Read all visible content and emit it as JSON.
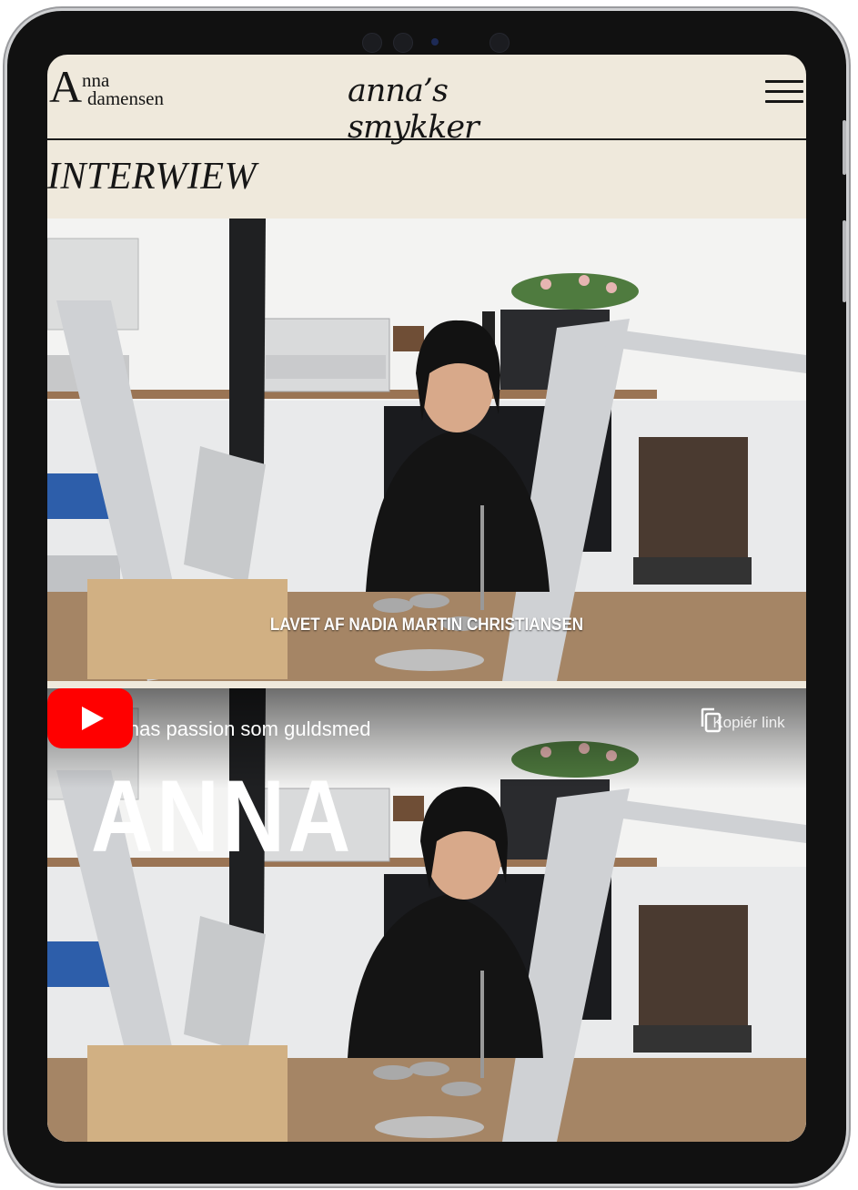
{
  "header": {
    "logo_initial": "A",
    "logo_line1": "nna",
    "logo_line2": "damensen",
    "brand_title": "anna’s smykker",
    "menu_icon": "hamburger-icon"
  },
  "section": {
    "title": "INTERWIEW"
  },
  "hero": {
    "credit": "LAVET AF NADIA MARTIN CHRISTIANSEN"
  },
  "video": {
    "title": "Annas passion som guldsmed",
    "copy_link_label": "Kopiér link",
    "overlay_word": "ANNA",
    "play_icon": "youtube-play-icon",
    "copy_icon": "copy-icon",
    "accent": "#ff0000"
  },
  "colors": {
    "page_bg": "#efe9dc",
    "ink": "#161616"
  }
}
